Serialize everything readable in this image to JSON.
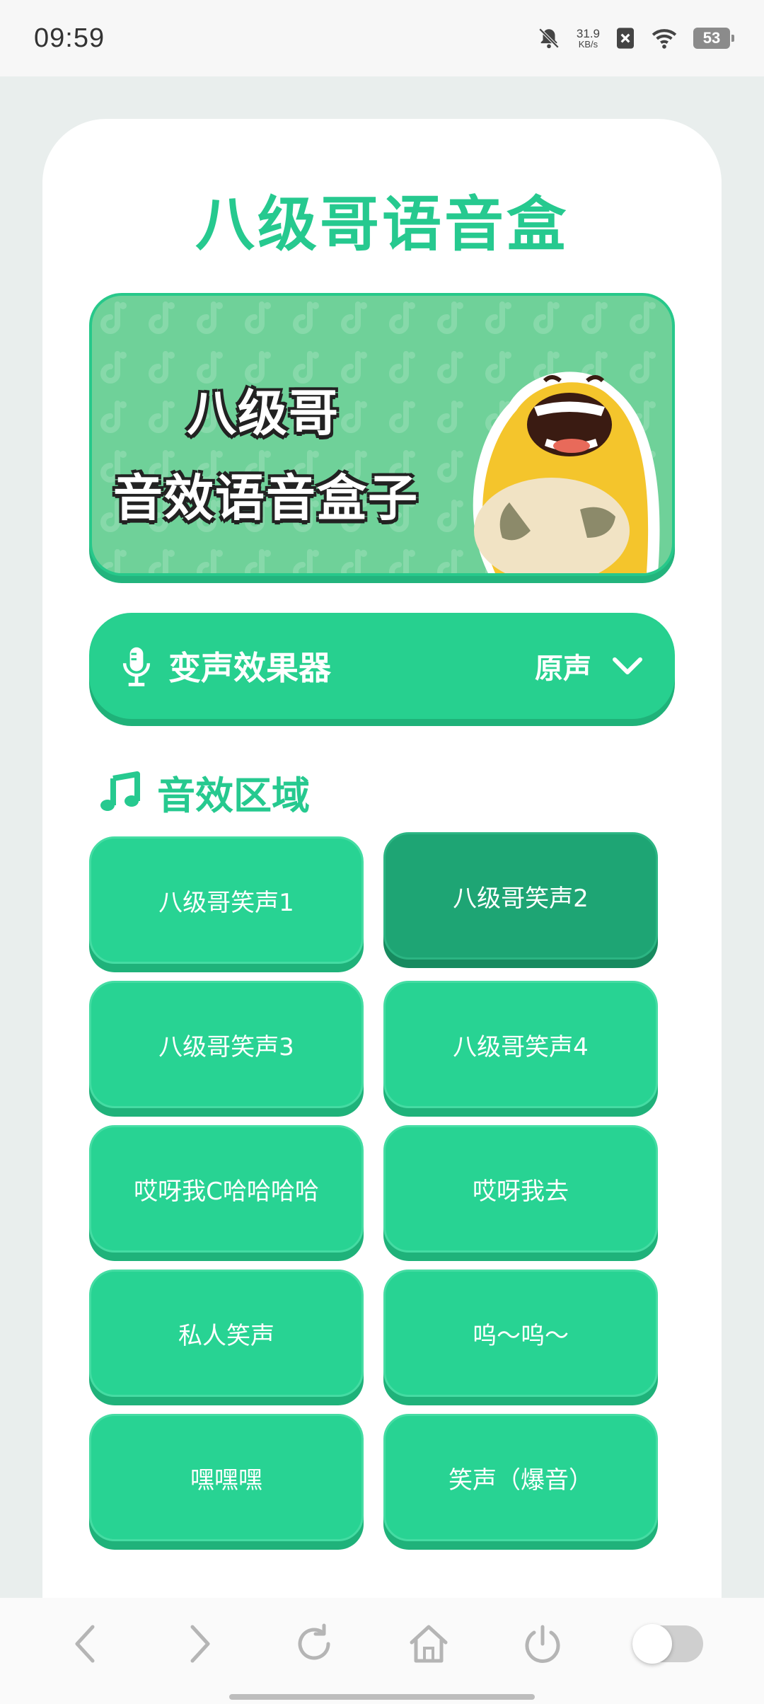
{
  "status_bar": {
    "time": "09:59",
    "net_speed_value": "31.9",
    "net_speed_unit": "KB/s",
    "battery": "53"
  },
  "app": {
    "title": "八级哥语音盒"
  },
  "banner": {
    "line1": "八级哥",
    "line2": "音效语音盒子"
  },
  "voice_changer": {
    "label": "变声效果器",
    "selected": "原声"
  },
  "sound_section": {
    "title": "音效区域",
    "items": [
      {
        "label": "八级哥笑声1"
      },
      {
        "label": "八级哥笑声2"
      },
      {
        "label": "八级哥笑声3"
      },
      {
        "label": "八级哥笑声4"
      },
      {
        "label": "哎呀我C哈哈哈哈"
      },
      {
        "label": "哎呀我去"
      },
      {
        "label": "私人笑声"
      },
      {
        "label": "呜～呜～"
      },
      {
        "label": "嘿嘿嘿"
      },
      {
        "label": "笑声（爆音）"
      }
    ]
  },
  "colors": {
    "accent": "#26c98f",
    "button": "#28d393",
    "button_active": "#1ea574"
  },
  "bottom_nav": {
    "icons": [
      "back-icon",
      "forward-icon",
      "refresh-icon",
      "home-icon",
      "power-icon",
      "toggle-switch"
    ]
  }
}
